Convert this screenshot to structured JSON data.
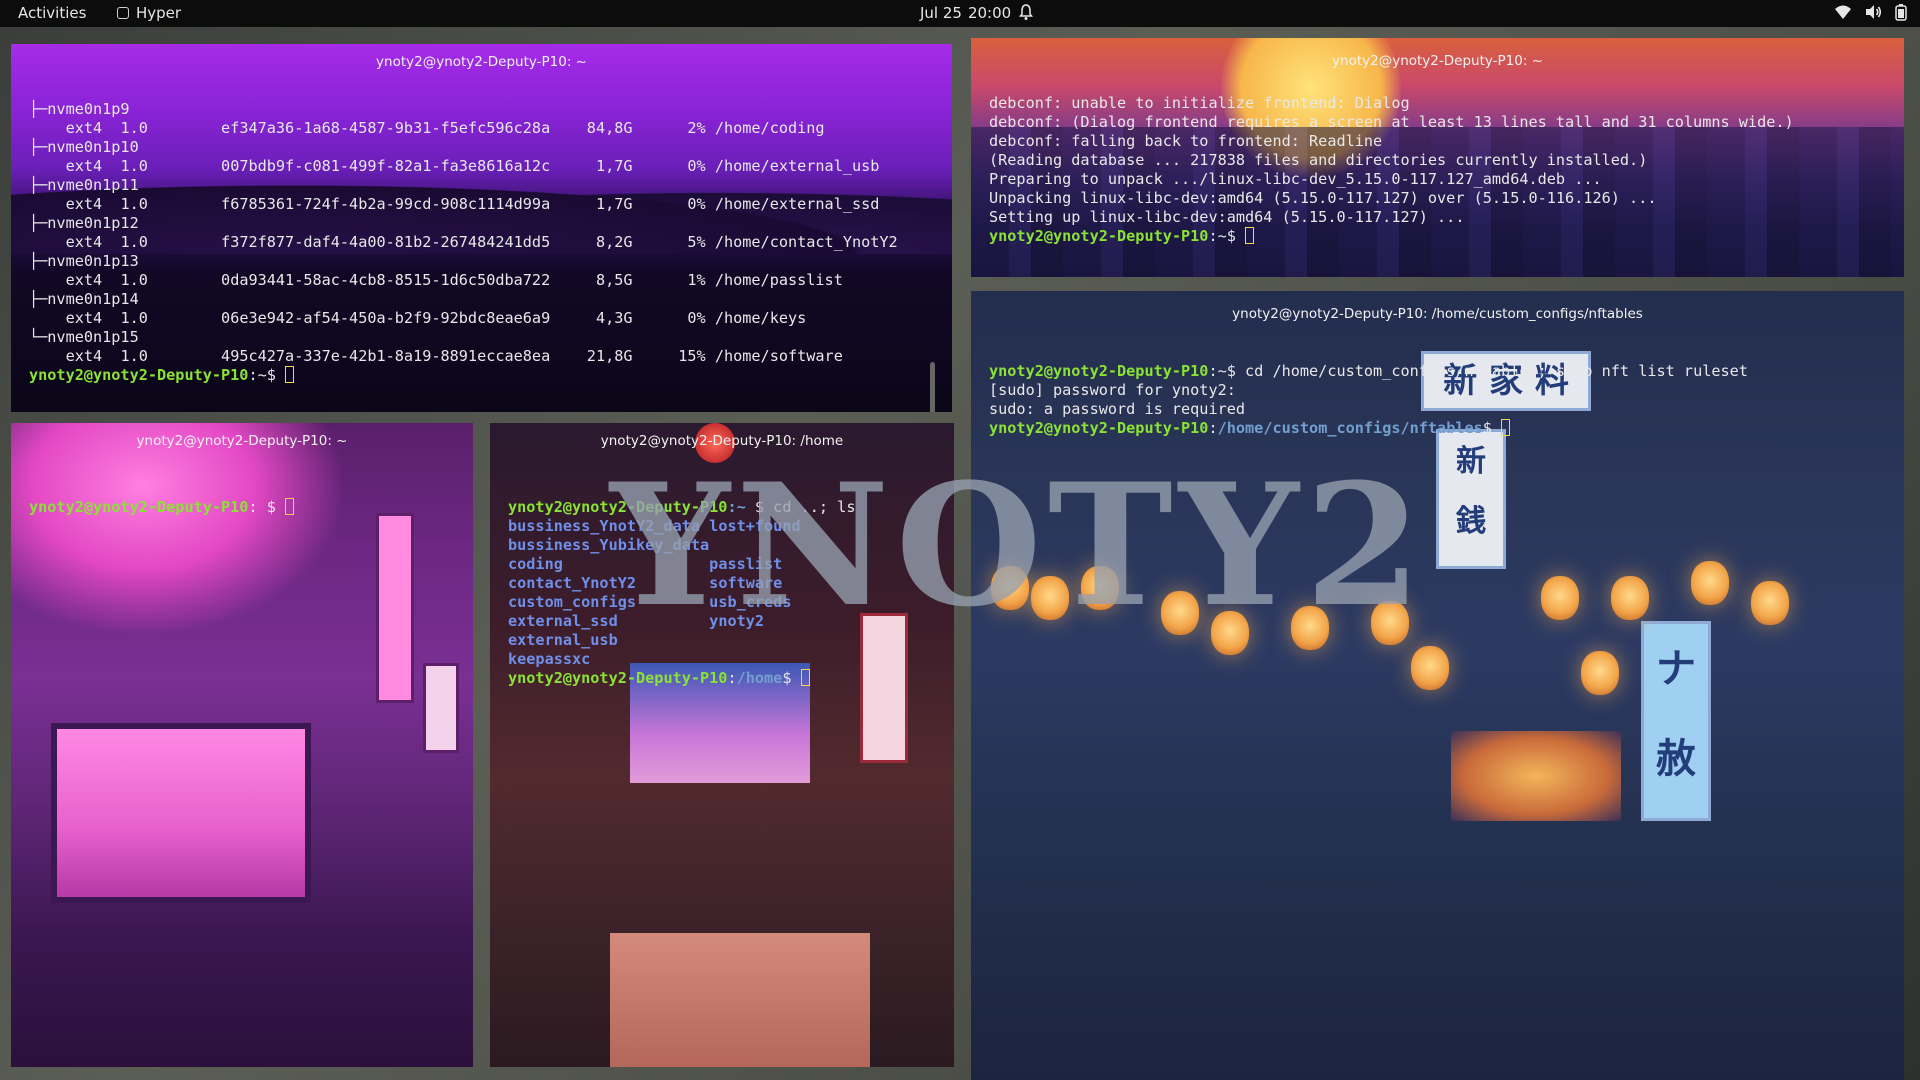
{
  "topbar": {
    "activities": "Activities",
    "app_name": "Hyper",
    "date": "Jul 25",
    "time": "20:00"
  },
  "watermark": "YNOTY2",
  "windows": {
    "lsblk": {
      "title": "ynoty2@ynoty2-Deputy-P10: ~",
      "rows": [
        {
          "tree": "├─nvme0n1p9"
        },
        {
          "fs": "ext4",
          "ver": "1.0",
          "uuid": "ef347a36-1a68-4587-9b31-f5efc596c28a",
          "avail": "84,8G",
          "use": "2%",
          "mount": "/home/coding"
        },
        {
          "tree": "├─nvme0n1p10"
        },
        {
          "fs": "ext4",
          "ver": "1.0",
          "uuid": "007bdb9f-c081-499f-82a1-fa3e8616a12c",
          "avail": "1,7G",
          "use": "0%",
          "mount": "/home/external_usb"
        },
        {
          "tree": "├─nvme0n1p11"
        },
        {
          "fs": "ext4",
          "ver": "1.0",
          "uuid": "f6785361-724f-4b2a-99cd-908c1114d99a",
          "avail": "1,7G",
          "use": "0%",
          "mount": "/home/external_ssd"
        },
        {
          "tree": "├─nvme0n1p12"
        },
        {
          "fs": "ext4",
          "ver": "1.0",
          "uuid": "f372f877-daf4-4a00-81b2-267484241dd5",
          "avail": "8,2G",
          "use": "5%",
          "mount": "/home/contact_YnotY2"
        },
        {
          "tree": "├─nvme0n1p13"
        },
        {
          "fs": "ext4",
          "ver": "1.0",
          "uuid": "0da93441-58ac-4cb8-8515-1d6c50dba722",
          "avail": "8,5G",
          "use": "1%",
          "mount": "/home/passlist"
        },
        {
          "tree": "├─nvme0n1p14"
        },
        {
          "fs": "ext4",
          "ver": "1.0",
          "uuid": "06e3e942-af54-450a-b2f9-92bdc8eae6a9",
          "avail": "4,3G",
          "use": "0%",
          "mount": "/home/keys"
        },
        {
          "tree": "└─nvme0n1p15"
        },
        {
          "fs": "ext4",
          "ver": "1.0",
          "uuid": "495c427a-337e-42b1-8a19-8891eccae8ea",
          "avail": "21,8G",
          "use": "15%",
          "mount": "/home/software"
        }
      ],
      "prompt_user": "ynoty2@ynoty2-Deputy-P10",
      "prompt_rest": ":~$ "
    },
    "debconf": {
      "title": "ynoty2@ynoty2-Deputy-P10: ~",
      "lines": [
        "debconf: unable to initialize frontend: Dialog",
        "debconf: (Dialog frontend requires a screen at least 13 lines tall and 31 columns wide.)",
        "debconf: falling back to frontend: Readline",
        "(Reading database ... 217838 files and directories currently installed.)",
        "Preparing to unpack .../linux-libc-dev_5.15.0-117.127_amd64.deb ...",
        "Unpacking linux-libc-dev:amd64 (5.15.0-117.127) over (5.15.0-116.126) ...",
        "Setting up linux-libc-dev:amd64 (5.15.0-117.127) ..."
      ],
      "prompt_user": "ynoty2@ynoty2-Deputy-P10",
      "prompt_rest": ":~$ "
    },
    "nftables": {
      "title": "ynoty2@ynoty2-Deputy-P10: /home/custom_configs/nftables",
      "prompt_user": "ynoty2@ynoty2-Deputy-P10",
      "prompt_path": ":~$ ",
      "command": "cd /home/custom_configs/nftables; sudo nft list ruleset",
      "output": [
        "[sudo] password for ynoty2:",
        "sudo: a password is required"
      ],
      "prompt2_user": "ynoty2@ynoty2-Deputy-P10",
      "prompt2_path": "/home/custom_configs/nftables",
      "prompt2_tail": "$ "
    },
    "pink": {
      "title": "ynoty2@ynoty2-Deputy-P10: ~",
      "prompt_user": "ynoty2@ynoty2-Deputy-P10",
      "prompt_rest": ": $ "
    },
    "home": {
      "title": "ynoty2@ynoty2-Deputy-P10: /home",
      "prompt_user": "ynoty2@ynoty2-Deputy-P10",
      "prompt_path": ":~",
      "command": "$ cd ..; ls",
      "ls_left": [
        "bussiness_YnotY2_data",
        "bussiness_Yubikey_data",
        "coding",
        "contact_YnotY2",
        "custom_configs",
        "external_ssd",
        "external_usb",
        "keepassxc"
      ],
      "ls_right": [
        "lost+found",
        "",
        "passlist",
        "software",
        "usb_creds",
        "ynoty2",
        "",
        ""
      ],
      "prompt2_user": "ynoty2@ynoty2-Deputy-P10",
      "prompt2_path": "/home",
      "prompt2_tail": "$ "
    }
  }
}
